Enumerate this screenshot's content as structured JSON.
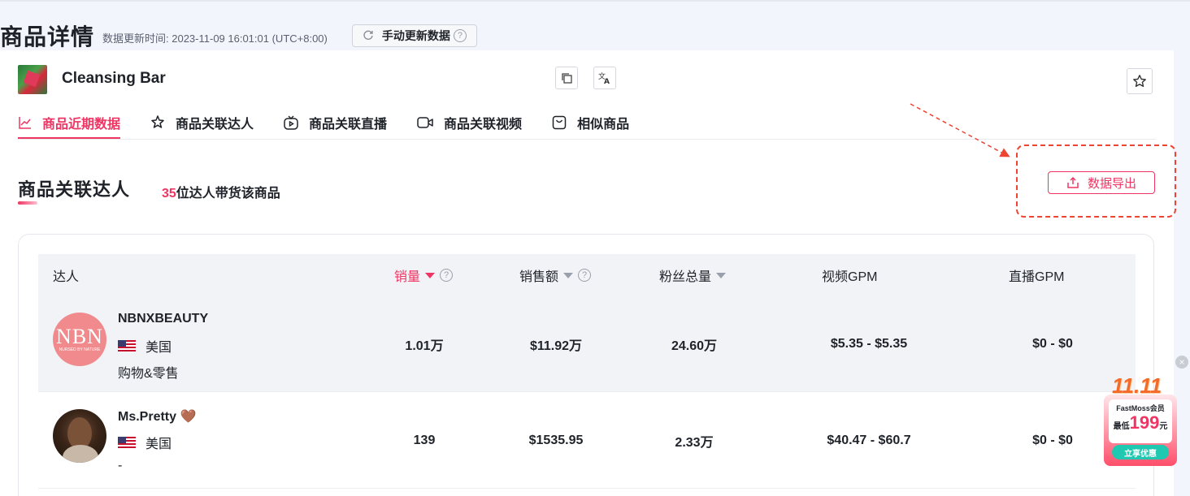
{
  "page": {
    "title": "商品详情",
    "update_time": "数据更新时间:  2023-11-09 16:01:01 (UTC+8:00)",
    "refresh_label": "手动更新数据"
  },
  "product": {
    "name": "Cleansing Bar"
  },
  "tabs": [
    {
      "label": "商品近期数据",
      "icon": "line-chart-icon",
      "active": true
    },
    {
      "label": "商品关联达人",
      "icon": "star-person-icon",
      "active": false
    },
    {
      "label": "商品关联直播",
      "icon": "live-icon",
      "active": false
    },
    {
      "label": "商品关联视频",
      "icon": "video-icon",
      "active": false
    },
    {
      "label": "相似商品",
      "icon": "bag-icon",
      "active": false
    }
  ],
  "section": {
    "title": "商品关联达人",
    "count": "35",
    "count_suffix": "位达人带货该商品",
    "export_label": "数据导出"
  },
  "table": {
    "columns": [
      "达人",
      "销量",
      "销售额",
      "粉丝总量",
      "视频GPM",
      "直播GPM"
    ],
    "rows": [
      {
        "name": "NBNXBEAUTY",
        "avatar_text": "NBN",
        "avatar_sub": "NURSED BY NATURE",
        "country": "美国",
        "category": "购物&零售",
        "sales": "1.01万",
        "revenue": "$11.92万",
        "followers": "24.60万",
        "video_gpm": "$5.35 - $5.35",
        "live_gpm": "$0 - $0"
      },
      {
        "name": "Ms.Pretty 🤎",
        "country": "美国",
        "category": "-",
        "sales": "139",
        "revenue": "$1535.95",
        "followers": "2.33万",
        "video_gpm": "$40.47 - $60.7",
        "live_gpm": "$0 - $0"
      }
    ]
  },
  "promo": {
    "headline": "11.11",
    "brand": "FastMoss会员",
    "price_prefix": "最低",
    "price": "199",
    "price_suffix": "元",
    "cta": "立享优惠",
    "close": "×"
  },
  "colors": {
    "accent": "#ee3563",
    "annotation": "#ee4433"
  }
}
